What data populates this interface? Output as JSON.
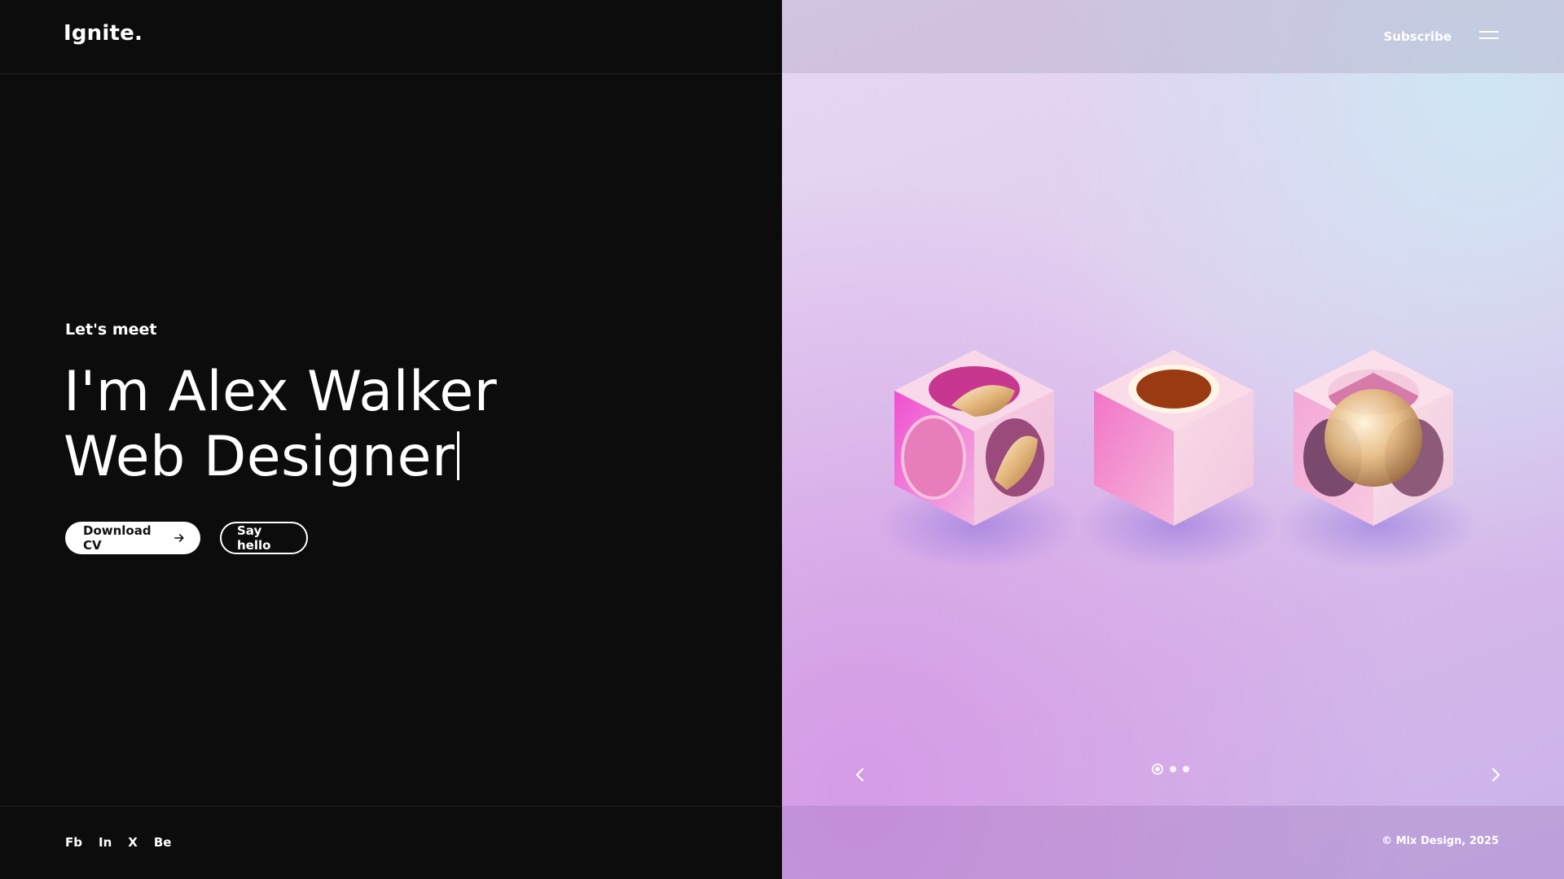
{
  "header": {
    "logo": "Ignite.",
    "subscribe_label": "Subscribe",
    "menu_icon": "hamburger-icon"
  },
  "intro": {
    "eyebrow": "Let's meet",
    "headline_line1": "I'm Alex Walker",
    "headline_line2": "Web Designer"
  },
  "buttons": {
    "download_label": "Download CV",
    "download_icon": "arrow-right-icon",
    "hello_label": "Say hello"
  },
  "footer": {
    "socials": [
      "Fb",
      "In",
      "X",
      "Be"
    ],
    "copyright": "© Mix Design, 2025"
  },
  "slider": {
    "prev_icon": "chevron-left-icon",
    "next_icon": "chevron-right-icon",
    "dot_count": 3,
    "active_index": 0
  },
  "colors": {
    "background": "#0c0c0c",
    "text": "#ffffff",
    "hero_lavender": "#e1cdef",
    "hero_pink": "#d59be6",
    "hero_blue": "#cfe6f4"
  }
}
